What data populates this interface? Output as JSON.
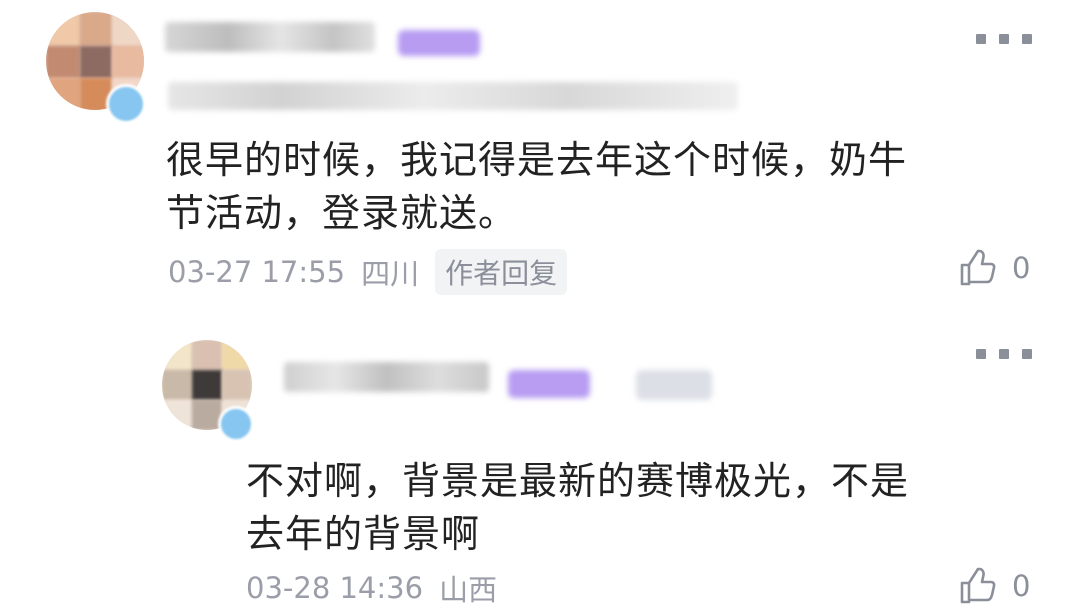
{
  "comments": [
    {
      "text": "很早的时候，我记得是去年这个时候，奶牛节活动，登录就送。",
      "date": "03-27 17:55",
      "location": "四川",
      "reply_tag": "作者回复",
      "likes": "0",
      "like_icon": "thumbs-up-icon",
      "more_icon": "more-icon"
    },
    {
      "text": "不对啊，背景是最新的赛博极光，不是去年的背景啊",
      "date": "03-28 14:36",
      "location": "山西",
      "likes": "0",
      "like_icon": "thumbs-up-icon",
      "more_icon": "more-icon"
    }
  ],
  "colors": {
    "text_primary": "#222222",
    "text_meta": "#9b9ea8",
    "tag_bg": "#f2f3f5",
    "badge_purple": "#b79cf2"
  }
}
